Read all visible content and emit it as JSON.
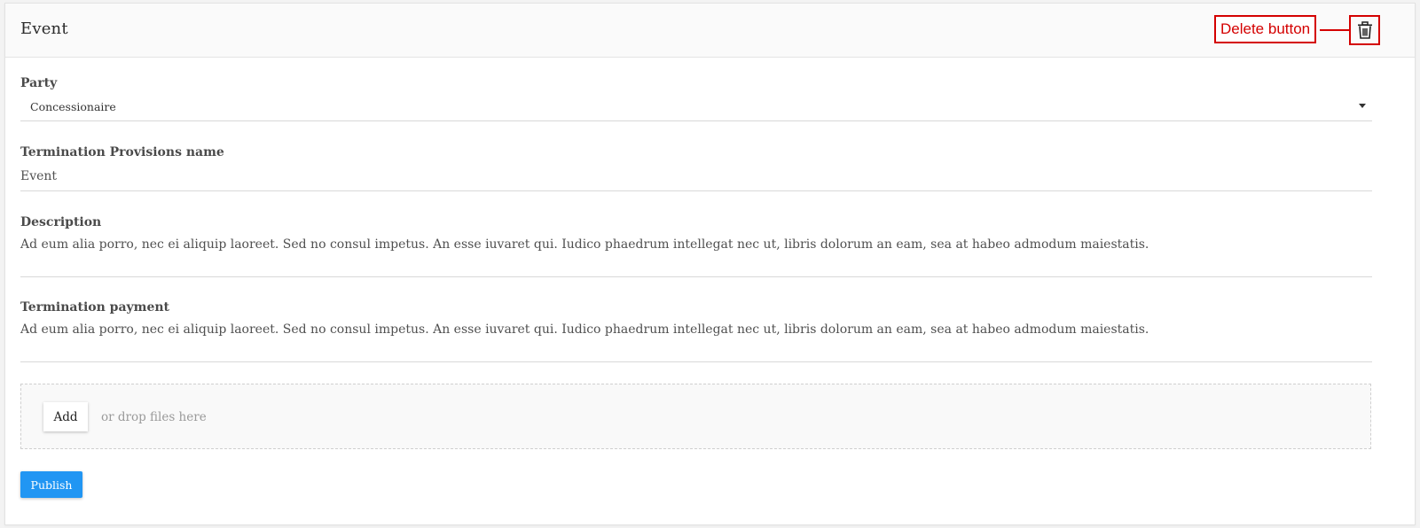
{
  "header": {
    "title": "Event",
    "annotation": "Delete button",
    "delete_icon": "trash-icon",
    "annotation_color": "#d40000"
  },
  "party": {
    "label": "Party",
    "value": "Concessionaire"
  },
  "name_field": {
    "label": "Termination Provisions name",
    "value": "Event"
  },
  "description": {
    "label": "Description",
    "value": "Ad eum alia porro, nec ei aliquip laoreet. Sed no consul impetus. An esse iuvaret qui. Iudico phaedrum intellegat nec ut, libris dolorum an eam, sea at habeo admodum maiestatis."
  },
  "payment": {
    "label": "Termination payment",
    "value": "Ad eum alia porro, nec ei aliquip laoreet. Sed no consul impetus. An esse iuvaret qui. Iudico phaedrum intellegat nec ut, libris dolorum an eam, sea at habeo admodum maiestatis."
  },
  "upload": {
    "add_label": "Add",
    "hint": "or drop files here"
  },
  "actions": {
    "publish_label": "Publish",
    "publish_color": "#2196f3"
  }
}
